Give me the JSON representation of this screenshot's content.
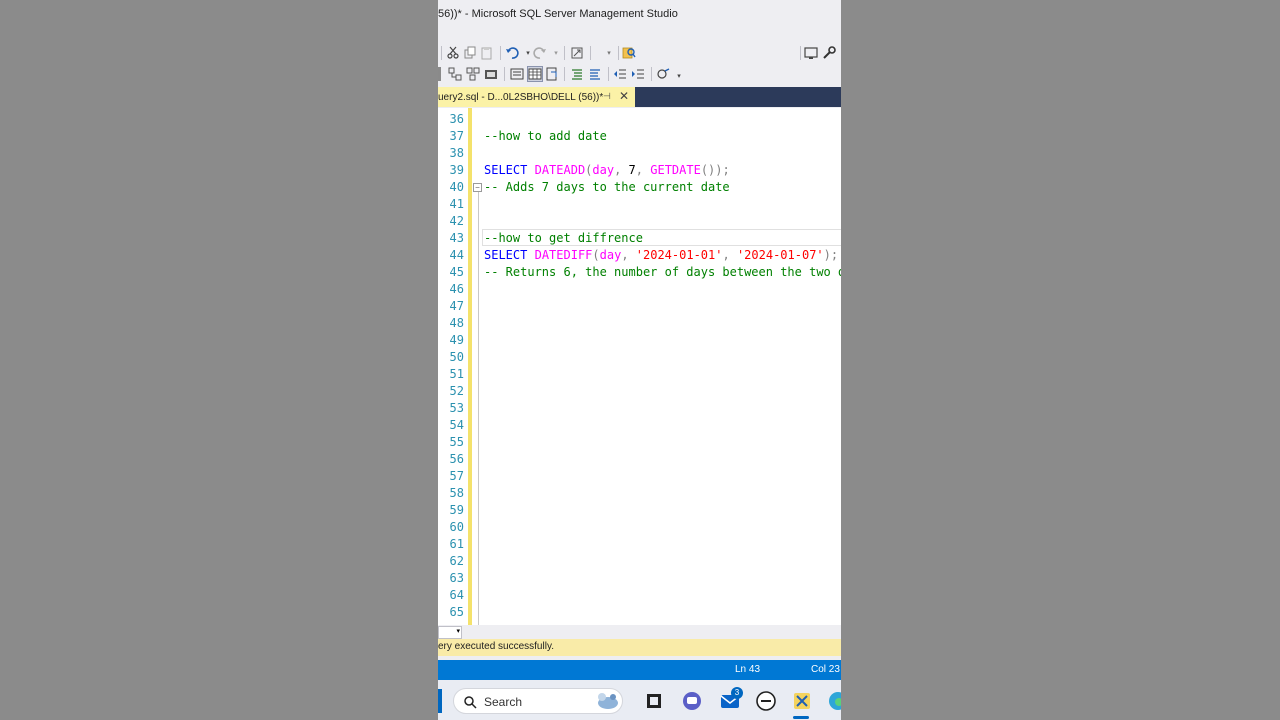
{
  "window": {
    "title": "56))* - Microsoft SQL Server Management Studio"
  },
  "toolbar": {
    "database_value": "#"
  },
  "tab": {
    "label": "uery2.sql - D...0L2SBHO\\DELL (56))*",
    "pin_glyph": "⊣",
    "close_glyph": "✕"
  },
  "editor": {
    "line_numbers": [
      "36",
      "37",
      "38",
      "39",
      "40",
      "41",
      "42",
      "43",
      "44",
      "45",
      "46",
      "47",
      "48",
      "49",
      "50",
      "51",
      "52",
      "53",
      "54",
      "55",
      "56",
      "57",
      "58",
      "59",
      "60",
      "61",
      "62",
      "63",
      "64",
      "65"
    ],
    "line37_comment": "--how to add date",
    "line39": {
      "kw_select": "SELECT",
      "fn_dateadd": "DATEADD",
      "paren_open": "(",
      "arg_day": "day",
      "comma1": ",",
      "arg_num": " 7",
      "comma2": ",",
      "fn_getdate": "GETDATE",
      "close": "());"
    },
    "line40_comment": "-- Adds 7 days to the current date",
    "line43_comment": "--how to get diffrence",
    "line44": {
      "kw_select": "SELECT",
      "fn_datediff": "DATEDIFF",
      "paren_open": "(",
      "arg_day": "day",
      "comma1": ",",
      "str1": "'2024-01-01'",
      "comma2": ",",
      "str2": "'2024-01-07'",
      "close": ");"
    },
    "line45_comment": "-- Returns 6, the number of days between the two d"
  },
  "status": {
    "message": "ery executed successfully.",
    "line": "Ln 43",
    "column": "Col 23"
  },
  "taskbar": {
    "search_label": "Search",
    "mail_badge": "3"
  },
  "colors": {
    "keyword": "#0000ff",
    "function": "#ff00ff",
    "string": "#ff0000",
    "comment": "#008000",
    "line_number": "#2b91af",
    "status_blue": "#0078d4"
  }
}
